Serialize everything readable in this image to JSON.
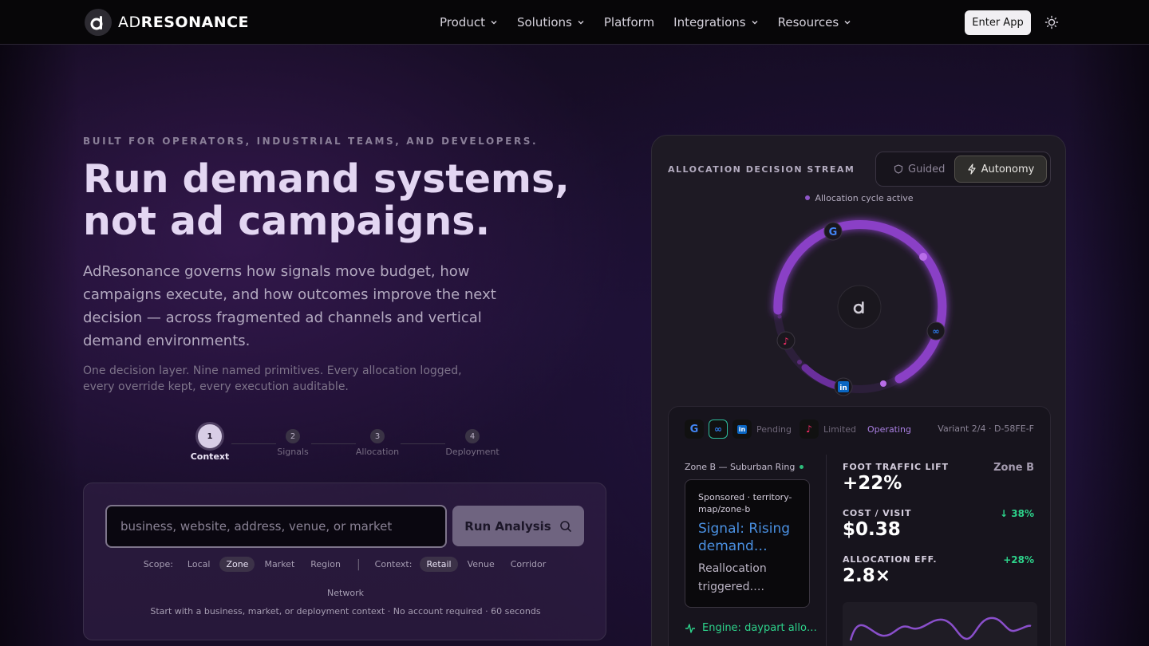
{
  "brand": {
    "prefix": "AD",
    "suffix": "RESONANCE"
  },
  "nav": {
    "links": [
      {
        "label": "Product",
        "dropdown": true
      },
      {
        "label": "Solutions",
        "dropdown": true
      },
      {
        "label": "Platform",
        "dropdown": false
      },
      {
        "label": "Integrations",
        "dropdown": true
      },
      {
        "label": "Resources",
        "dropdown": true
      }
    ],
    "cta": "Enter App",
    "theme_icon": "sun-icon"
  },
  "hero": {
    "eyebrow": "BUILT FOR OPERATORS, INDUSTRIAL TEAMS, AND DEVELOPERS.",
    "headline_1": "Run demand systems,",
    "headline_2": "not ad campaigns.",
    "lede": "AdResonance governs how signals move budget, how campaigns execute, and how outcomes improve the next decision — across fragmented ad channels and vertical demand environments.",
    "sub": "One decision layer. Nine named primitives. Every allocation logged, every override kept, every execution auditable."
  },
  "stepper": {
    "steps": [
      {
        "num": "1",
        "label": "Context"
      },
      {
        "num": "2",
        "label": "Signals"
      },
      {
        "num": "3",
        "label": "Allocation"
      },
      {
        "num": "4",
        "label": "Deployment"
      }
    ],
    "active": 0
  },
  "search": {
    "placeholder": "business, website, address, venue, or market",
    "value": "",
    "button": "Run Analysis",
    "scope_label": "Scope:",
    "scope_options": [
      "Local",
      "Zone",
      "Market",
      "Region"
    ],
    "scope_selected": "Zone",
    "context_label": "Context:",
    "context_options": [
      "Retail",
      "Venue",
      "Corridor",
      "Network"
    ],
    "context_selected": "Retail",
    "separator": "|",
    "note": "Start with a business, market, or deployment context · No account required · 60 seconds"
  },
  "panel": {
    "title": "ALLOCATION DECISION STREAM",
    "modes": [
      "Guided",
      "Autonomy"
    ],
    "mode_active": "Autonomy",
    "cycle_status": "Allocation cycle active",
    "channels": {
      "pending_label": "Pending",
      "limited_label": "Limited",
      "operating_label": "Operating",
      "variant": "Variant 2/4 · D-58FE-F"
    },
    "zone": "Zone B — Suburban Ring",
    "ad": {
      "sponsor": "Sponsored · territory-map/zone-b",
      "title": "Signal: Rising demand…",
      "body": "Reallocation triggered…."
    },
    "engine": "Engine: daypart allo…",
    "metrics": [
      {
        "label": "FOOT TRAFFIC LIFT",
        "value": "+22%",
        "right": "Zone B",
        "right_color": "#a59cb0"
      },
      {
        "label": "COST / VISIT",
        "value": "$0.38",
        "right": "↓ 38%",
        "right_color": "#2dd38b"
      },
      {
        "label": "ALLOCATION EFF.",
        "value": "2.8×",
        "right": "+28%",
        "right_color": "#2dd38b"
      }
    ]
  },
  "colors": {
    "accent_purple": "#8e3fc4",
    "success_green": "#2dd38b",
    "link_blue": "#4a90e2"
  }
}
